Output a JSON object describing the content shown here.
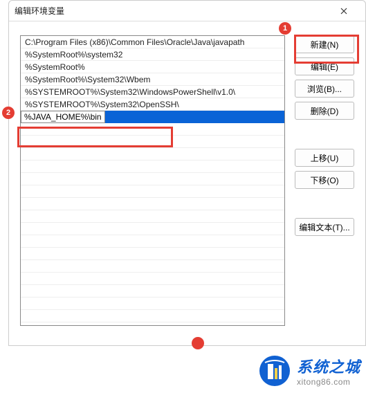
{
  "dialog": {
    "title": "编辑环境变量"
  },
  "path_entries": [
    "C:\\Program Files (x86)\\Common Files\\Oracle\\Java\\javapath",
    "%SystemRoot%\\system32",
    "%SystemRoot%",
    "%SystemRoot%\\System32\\Wbem",
    "%SYSTEMROOT%\\System32\\WindowsPowerShell\\v1.0\\",
    "%SYSTEMROOT%\\System32\\OpenSSH\\"
  ],
  "editing_value": "%JAVA_HOME%\\bin",
  "buttons": {
    "new": "新建(N)",
    "edit": "编辑(E)",
    "browse": "浏览(B)...",
    "delete": "删除(D)",
    "move_up": "上移(U)",
    "move_down": "下移(O)",
    "edit_text": "编辑文本(T)..."
  },
  "annotations": {
    "badge1": "1",
    "badge2": "2",
    "badge3": ""
  },
  "watermark": {
    "title": "系统之城",
    "url": "xitong86.com"
  }
}
